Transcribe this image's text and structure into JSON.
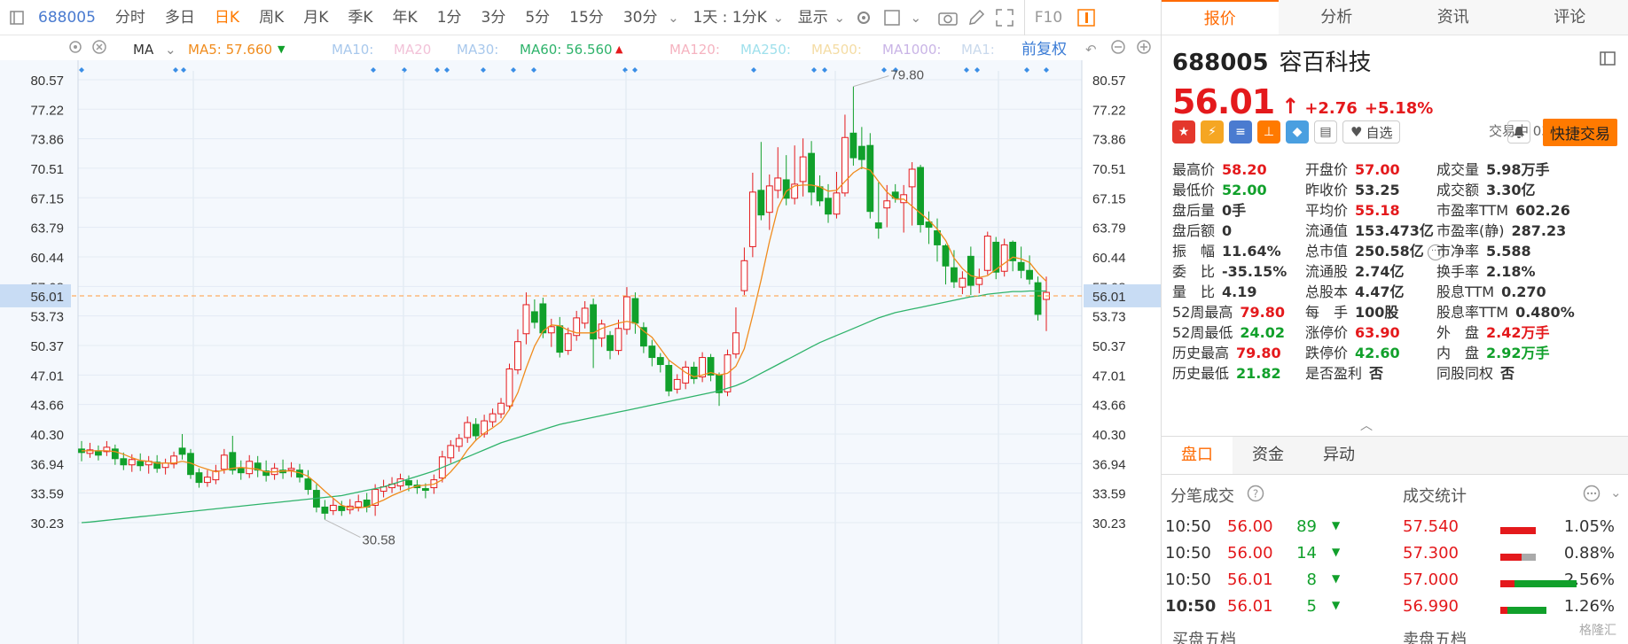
{
  "toolbar": {
    "code": "688005",
    "items": [
      "分时",
      "多日",
      "日K",
      "周K",
      "月K",
      "季K",
      "年K",
      "1分",
      "3分",
      "5分",
      "15分",
      "30分"
    ],
    "active": "日K",
    "range": "1天 : 1分K",
    "display": "显示",
    "f10": "F10"
  },
  "ma_bar": {
    "label": "MA",
    "ma5": "MA5: 57.660",
    "ma10": "MA10:",
    "ma20": "MA20",
    "ma30": "MA30:",
    "ma60": "MA60: 56.560",
    "ma120": "MA120:",
    "ma250": "MA250:",
    "ma500": "MA500:",
    "ma1000": "MA1000:",
    "ma1": "MA1:",
    "adjust": "前复权"
  },
  "colors": {
    "up": "#e4191c",
    "down": "#11a02b",
    "ma5": "#f08c1e",
    "ma60": "#2fb36b",
    "accent": "#ff7a00"
  },
  "chart_data": {
    "type": "candlestick",
    "y_ticks": [
      "80.57",
      "77.22",
      "73.86",
      "70.51",
      "67.15",
      "63.79",
      "60.44",
      "57.08",
      "53.73",
      "50.37",
      "47.01",
      "43.66",
      "40.30",
      "36.94",
      "33.59",
      "30.23"
    ],
    "ylim": [
      30.23,
      80.57
    ],
    "current_price": "56.01",
    "high_label": "79.80",
    "low_label": "30.58",
    "candles": [
      [
        38.6,
        38.2,
        39.5,
        37.2
      ],
      [
        38.1,
        38.5,
        39.3,
        37.6
      ],
      [
        38.4,
        37.9,
        39.0,
        37.3
      ],
      [
        38.3,
        38.8,
        39.5,
        37.8
      ],
      [
        38.6,
        37.5,
        39.1,
        36.8
      ],
      [
        37.5,
        36.8,
        38.2,
        36.2
      ],
      [
        36.8,
        37.4,
        38.0,
        36.0
      ],
      [
        37.2,
        36.7,
        38.1,
        36.1
      ],
      [
        36.8,
        37.2,
        37.8,
        35.8
      ],
      [
        37.1,
        36.4,
        37.9,
        35.9
      ],
      [
        36.5,
        37.0,
        37.5,
        35.7
      ],
      [
        36.9,
        37.8,
        38.3,
        36.4
      ],
      [
        38.7,
        38.0,
        40.3,
        37.4
      ],
      [
        38.1,
        35.7,
        38.6,
        35.2
      ],
      [
        35.9,
        34.8,
        36.4,
        34.2
      ],
      [
        34.8,
        35.4,
        36.2,
        34.3
      ],
      [
        35.1,
        36.1,
        36.8,
        34.6
      ],
      [
        36.3,
        37.9,
        38.6,
        35.8
      ],
      [
        38.2,
        36.2,
        40.1,
        35.7
      ],
      [
        36.4,
        35.9,
        37.3,
        35.1
      ],
      [
        35.8,
        37.2,
        37.9,
        35.3
      ],
      [
        37.0,
        36.2,
        37.8,
        35.4
      ],
      [
        36.1,
        35.6,
        37.3,
        34.9
      ],
      [
        35.7,
        36.4,
        37.0,
        35.1
      ],
      [
        36.2,
        35.9,
        37.4,
        35.2
      ],
      [
        36.2,
        36.4,
        37.1,
        35.4
      ],
      [
        36.2,
        35.4,
        36.9,
        34.8
      ],
      [
        35.2,
        34.0,
        36.2,
        33.4
      ],
      [
        33.9,
        32.0,
        34.6,
        31.4
      ],
      [
        32.0,
        31.3,
        32.8,
        30.58
      ],
      [
        31.6,
        32.2,
        33.0,
        31.1
      ],
      [
        32.1,
        31.6,
        32.7,
        31.0
      ],
      [
        31.7,
        32.1,
        32.9,
        31.2
      ],
      [
        32.0,
        32.6,
        33.4,
        31.5
      ],
      [
        32.8,
        32.0,
        33.6,
        31.4
      ],
      [
        32.2,
        34.0,
        34.6,
        31.0
      ],
      [
        33.8,
        34.3,
        35.1,
        33.1
      ],
      [
        34.2,
        34.6,
        35.4,
        33.6
      ],
      [
        34.4,
        35.2,
        35.8,
        33.9
      ],
      [
        35.0,
        34.5,
        35.6,
        33.8
      ],
      [
        34.5,
        34.2,
        35.1,
        33.5
      ],
      [
        34.1,
        33.9,
        34.7,
        33.0
      ],
      [
        34.2,
        35.1,
        35.7,
        33.5
      ],
      [
        35.3,
        37.7,
        38.4,
        34.8
      ],
      [
        37.6,
        39.0,
        39.6,
        37.0
      ],
      [
        38.9,
        39.8,
        40.3,
        38.3
      ],
      [
        39.9,
        41.6,
        42.3,
        39.3
      ],
      [
        41.4,
        40.1,
        42.1,
        39.5
      ],
      [
        40.3,
        41.8,
        42.5,
        39.9
      ],
      [
        41.7,
        42.6,
        43.2,
        41.1
      ],
      [
        42.6,
        43.8,
        44.4,
        42.1
      ],
      [
        43.5,
        47.7,
        48.3,
        43.0
      ],
      [
        47.6,
        50.8,
        52.2,
        47.1
      ],
      [
        51.7,
        55.0,
        56.4,
        50.5
      ],
      [
        54.2,
        53.0,
        55.6,
        52.3
      ],
      [
        55.1,
        51.8,
        55.8,
        51.2
      ],
      [
        51.8,
        52.5,
        53.4,
        50.2
      ],
      [
        52.6,
        49.6,
        53.6,
        49.0
      ],
      [
        49.8,
        51.7,
        52.4,
        49.3
      ],
      [
        51.5,
        53.5,
        54.3,
        50.9
      ],
      [
        52.9,
        54.6,
        55.4,
        52.3
      ],
      [
        55.0,
        51.1,
        55.7,
        47.8
      ],
      [
        51.2,
        52.8,
        53.3,
        50.2
      ],
      [
        51.5,
        49.8,
        52.0,
        48.8
      ],
      [
        49.8,
        52.3,
        53.3,
        49.3
      ],
      [
        52.2,
        55.9,
        57.0,
        51.6
      ],
      [
        55.7,
        52.9,
        56.4,
        51.7
      ],
      [
        52.4,
        50.3,
        53.0,
        49.5
      ],
      [
        50.3,
        49.0,
        51.0,
        48.0
      ],
      [
        49.0,
        48.2,
        49.5,
        47.3
      ],
      [
        48.1,
        45.2,
        48.7,
        44.6
      ],
      [
        45.4,
        46.5,
        47.1,
        44.9
      ],
      [
        46.1,
        47.9,
        48.6,
        45.4
      ],
      [
        47.9,
        46.6,
        48.5,
        46.0
      ],
      [
        46.8,
        49.0,
        49.6,
        46.2
      ],
      [
        49.0,
        47.0,
        49.4,
        46.3
      ],
      [
        47.0,
        45.0,
        47.3,
        43.5
      ],
      [
        45.1,
        49.3,
        49.9,
        44.6
      ],
      [
        49.4,
        51.8,
        54.7,
        48.9
      ],
      [
        56.6,
        60.0,
        61.5,
        56.1
      ],
      [
        61.6,
        67.8,
        70.0,
        60.4
      ],
      [
        68.0,
        65.2,
        73.5,
        64.6
      ],
      [
        65.5,
        68.5,
        69.8,
        63.5
      ],
      [
        68.0,
        69.4,
        72.9,
        67.1
      ],
      [
        69.2,
        67.1,
        72.0,
        66.3
      ],
      [
        67.1,
        68.7,
        73.1,
        66.4
      ],
      [
        69.0,
        71.8,
        73.9,
        67.3
      ],
      [
        72.2,
        67.8,
        73.6,
        66.3
      ],
      [
        68.4,
        66.8,
        69.7,
        66.2
      ],
      [
        67.1,
        65.3,
        68.7,
        64.3
      ],
      [
        65.3,
        67.7,
        70.1,
        64.8
      ],
      [
        67.7,
        74.0,
        76.6,
        67.3
      ],
      [
        74.5,
        71.7,
        79.8,
        70.8
      ],
      [
        73.0,
        71.5,
        75.2,
        70.4
      ],
      [
        73.1,
        65.6,
        74.5,
        64.8
      ],
      [
        64.3,
        63.7,
        68.9,
        62.5
      ],
      [
        66.0,
        66.8,
        68.6,
        63.8
      ],
      [
        67.8,
        67.1,
        68.7,
        66.6
      ],
      [
        66.6,
        67.5,
        68.6,
        63.2
      ],
      [
        68.4,
        70.4,
        71.2,
        64.0
      ],
      [
        70.6,
        64.1,
        70.9,
        63.2
      ],
      [
        64.4,
        63.8,
        65.6,
        61.9
      ],
      [
        63.4,
        61.8,
        64.8,
        59.9
      ],
      [
        61.7,
        59.4,
        61.9,
        57.3
      ],
      [
        59.2,
        57.6,
        61.2,
        56.9
      ],
      [
        57.0,
        58.0,
        58.8,
        56.2
      ],
      [
        60.5,
        57.2,
        61.6,
        56.1
      ],
      [
        57.3,
        58.0,
        59.1,
        56.3
      ],
      [
        58.9,
        62.8,
        63.3,
        58.4
      ],
      [
        62.1,
        58.7,
        62.7,
        57.9
      ],
      [
        58.8,
        61.8,
        62.5,
        58.2
      ],
      [
        62.1,
        60.0,
        62.3,
        58.8
      ],
      [
        59.8,
        58.9,
        61.6,
        58.0
      ],
      [
        58.9,
        57.9,
        60.6,
        57.3
      ],
      [
        57.5,
        53.9,
        58.2,
        53.2
      ],
      [
        55.6,
        56.4,
        58.2,
        52.0
      ]
    ],
    "ma5": [
      38.4,
      38.4,
      38.4,
      38.4,
      38.3,
      38.0,
      37.6,
      37.3,
      37.2,
      37.0,
      37.0,
      37.0,
      37.2,
      37.0,
      36.6,
      36.3,
      36.0,
      36.2,
      36.4,
      36.5,
      36.4,
      36.3,
      36.0,
      36.0,
      36.1,
      36.1,
      35.9,
      35.5,
      34.7,
      33.8,
      33.0,
      32.2,
      31.9,
      31.9,
      32.0,
      32.4,
      32.8,
      33.3,
      33.7,
      34.1,
      34.4,
      34.5,
      34.6,
      35.1,
      36.0,
      37.1,
      38.5,
      39.6,
      40.4,
      41.0,
      41.7,
      43.1,
      45.0,
      47.8,
      50.3,
      52.0,
      52.7,
      52.6,
      52.1,
      51.8,
      51.8,
      51.8,
      52.3,
      52.6,
      52.9,
      53.1,
      52.9,
      52.0,
      51.3,
      50.0,
      48.7,
      48.0,
      47.3,
      46.8,
      47.0,
      47.3,
      47.0,
      47.2,
      48.0,
      50.0,
      53.8,
      57.8,
      62.2,
      66.0,
      67.9,
      68.5,
      68.6,
      68.6,
      68.4,
      67.9,
      68.0,
      69.0,
      70.0,
      70.6,
      70.3,
      69.0,
      67.8,
      67.0,
      67.0,
      66.2,
      65.4,
      64.6,
      63.6,
      62.3,
      60.3,
      59.1,
      58.3,
      58.1,
      58.3,
      59.0,
      59.7,
      60.4,
      60.2,
      59.8,
      58.6,
      57.66
    ],
    "ma60": [
      30.23,
      30.3,
      30.4,
      30.5,
      30.6,
      30.7,
      30.8,
      30.9,
      31.0,
      31.1,
      31.2,
      31.3,
      31.4,
      31.5,
      31.6,
      31.7,
      31.8,
      31.9,
      32.0,
      32.1,
      32.2,
      32.3,
      32.4,
      32.5,
      32.6,
      32.7,
      32.8,
      32.9,
      33.0,
      33.1,
      33.2,
      33.3,
      33.5,
      33.7,
      33.9,
      34.1,
      34.3,
      34.6,
      34.9,
      35.2,
      35.5,
      35.8,
      36.1,
      36.5,
      36.9,
      37.3,
      37.7,
      38.1,
      38.5,
      38.9,
      39.3,
      39.6,
      39.9,
      40.2,
      40.5,
      40.8,
      41.1,
      41.4,
      41.6,
      41.8,
      42.0,
      42.2,
      42.4,
      42.6,
      42.8,
      43.0,
      43.2,
      43.4,
      43.6,
      43.8,
      44.0,
      44.2,
      44.4,
      44.6,
      44.8,
      45.0,
      45.2,
      45.5,
      45.8,
      46.2,
      46.7,
      47.2,
      47.7,
      48.2,
      48.7,
      49.2,
      49.7,
      50.2,
      50.7,
      51.1,
      51.5,
      51.9,
      52.3,
      52.7,
      53.1,
      53.5,
      53.8,
      54.1,
      54.3,
      54.5,
      54.7,
      54.9,
      55.1,
      55.3,
      55.5,
      55.7,
      55.9,
      56.0,
      56.2,
      56.3,
      56.4,
      56.5,
      56.5,
      56.56,
      56.56,
      56.56
    ]
  },
  "panel": {
    "tabs": [
      "报价",
      "分析",
      "资讯",
      "评论"
    ],
    "active_tab": "报价",
    "code": "688005",
    "name": "容百科技",
    "price": "56.01",
    "change": "+2.76",
    "change_pct": "+5.18%",
    "status": "交易中 03/09 10:50",
    "fav": "自选",
    "quick_trade": "快捷交易",
    "stats": [
      {
        "l": "最高价",
        "v": "58.20",
        "c": "up"
      },
      {
        "l": "开盘价",
        "v": "57.00",
        "c": "up"
      },
      {
        "l": "成交量",
        "v": "5.98万手",
        "c": ""
      },
      {
        "l": "最低价",
        "v": "52.00",
        "c": "dn"
      },
      {
        "l": "昨收价",
        "v": "53.25",
        "c": ""
      },
      {
        "l": "成交额",
        "v": "3.30亿",
        "c": ""
      },
      {
        "l": "盘后量",
        "v": "0手",
        "c": ""
      },
      {
        "l": "平均价",
        "v": "55.18",
        "c": "up"
      },
      {
        "l": "市盈率TTM",
        "v": "602.26",
        "c": ""
      },
      {
        "l": "盘后额",
        "v": "0",
        "c": ""
      },
      {
        "l": "流通值",
        "v": "153.473亿",
        "c": ""
      },
      {
        "l": "市盈率(静)",
        "v": "287.23",
        "c": ""
      },
      {
        "l": "振　幅",
        "v": "11.64%",
        "c": ""
      },
      {
        "l": "总市值",
        "v": "250.58亿",
        "c": ""
      },
      {
        "l": "市净率",
        "v": "5.588",
        "c": ""
      },
      {
        "l": "委　比",
        "v": "-35.15%",
        "c": ""
      },
      {
        "l": "流通股",
        "v": "2.74亿",
        "c": ""
      },
      {
        "l": "换手率",
        "v": "2.18%",
        "c": ""
      },
      {
        "l": "量　比",
        "v": "4.19",
        "c": ""
      },
      {
        "l": "总股本",
        "v": "4.47亿",
        "c": ""
      },
      {
        "l": "股息TTM",
        "v": "0.270",
        "c": ""
      },
      {
        "l": "52周最高",
        "v": "79.80",
        "c": "up"
      },
      {
        "l": "每　手",
        "v": "100股",
        "c": ""
      },
      {
        "l": "股息率TTM",
        "v": "0.480%",
        "c": ""
      },
      {
        "l": "52周最低",
        "v": "24.02",
        "c": "dn"
      },
      {
        "l": "涨停价",
        "v": "63.90",
        "c": "up"
      },
      {
        "l": "外　盘",
        "v": "2.42万手",
        "c": "up"
      },
      {
        "l": "历史最高",
        "v": "79.80",
        "c": "up"
      },
      {
        "l": "跌停价",
        "v": "42.60",
        "c": "dn"
      },
      {
        "l": "内　盘",
        "v": "2.92万手",
        "c": "dn"
      },
      {
        "l": "历史最低",
        "v": "21.82",
        "c": "dn"
      },
      {
        "l": "是否盈利",
        "v": "否",
        "c": ""
      },
      {
        "l": "同股同权",
        "v": "否",
        "c": ""
      }
    ],
    "tabs2": [
      "盘口",
      "资金",
      "异动"
    ],
    "active_tab2": "盘口",
    "trades_title": "分笔成交",
    "stats_title": "成交统计",
    "trades": [
      {
        "t": "10:50",
        "p": "56.00",
        "v": "89"
      },
      {
        "t": "10:50",
        "p": "56.00",
        "v": "14"
      },
      {
        "t": "10:50",
        "p": "56.01",
        "v": "8"
      },
      {
        "t": "10:50",
        "p": "56.01",
        "v": "5"
      }
    ],
    "trade_stats": [
      {
        "p": "57.540",
        "pct": "1.05%",
        "red": 1.0,
        "grey": 0.0
      },
      {
        "p": "57.300",
        "pct": "0.88%",
        "red": 0.6,
        "grey": 0.4
      },
      {
        "p": "57.000",
        "pct": "2.56%",
        "red": 0.4,
        "grey": 0.0
      },
      {
        "p": "56.990",
        "pct": "1.26%",
        "red": 0.2,
        "grey": 0.0
      }
    ],
    "bottom_left": "买盘五档",
    "bottom_right": "卖盘五档",
    "watermark": "格隆汇"
  }
}
